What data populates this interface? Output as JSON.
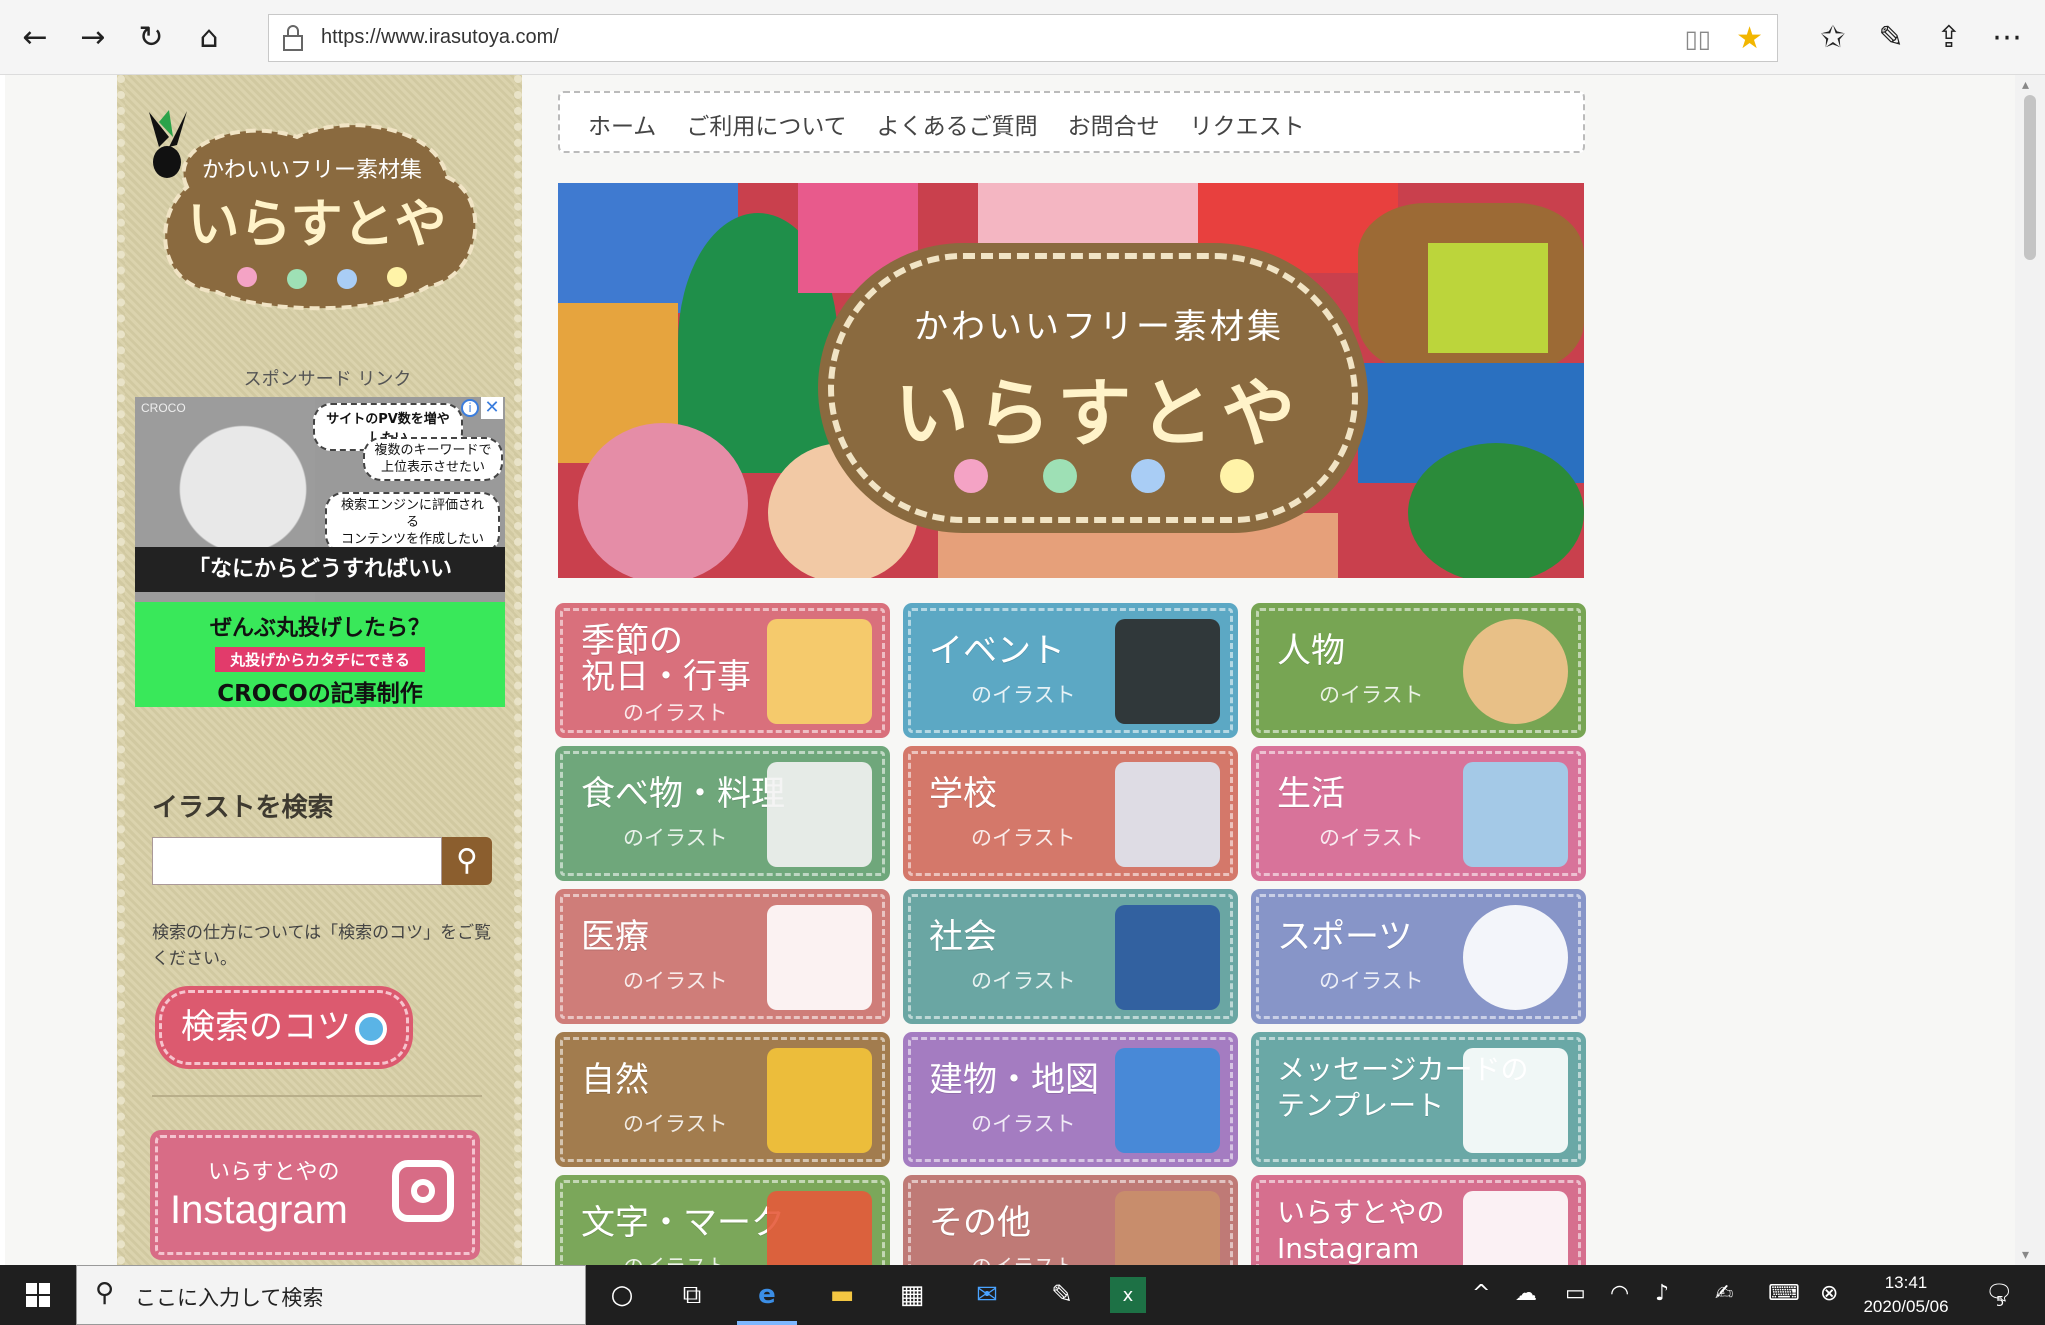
{
  "browser": {
    "url": "https://www.irasutoya.com/",
    "nav_icons": [
      "back-icon",
      "forward-icon",
      "refresh-icon",
      "home-icon"
    ],
    "right_icons": [
      "favorites-icon",
      "pen-icon",
      "share-icon",
      "more-icon"
    ]
  },
  "site": {
    "logo": {
      "small": "かわいいフリー素材集",
      "big": "いらすとや"
    },
    "sponsor_label": "スポンサード リンク",
    "ad": {
      "brand_tag": "CROCO",
      "bubble1": "サイトのPV数を増やしたい",
      "bubble2_l1": "複数のキーワードで",
      "bubble2_l2": "上位表示させたい",
      "bubble3_l1": "検索エンジンに評価される",
      "bubble3_l2": "コンテンツを作成したい",
      "mid": "「なにからどうすればいいの・・・？」",
      "g1": "ぜんぶ丸投げしたら？",
      "g2": "丸投げからカタチにできる",
      "g3": "CROCOの記事制作"
    },
    "search": {
      "title": "イラストを検索",
      "input_value": "",
      "note": "検索の仕方については「検索のコツ」をご覧ください。",
      "tips_button": "検索のコツ"
    },
    "instagram": {
      "small": "いらすとやの",
      "big": "Instagram"
    },
    "nav": [
      "ホーム",
      "ご利用について",
      "よくあるご質問",
      "お問合せ",
      "リクエスト"
    ],
    "hero": {
      "small": "かわいいフリー素材集",
      "big": "いらすとや"
    },
    "categories": [
      {
        "title": "季節の\n祝日・行事",
        "sub": "のイラスト",
        "color": "#d9707c"
      },
      {
        "title": "イベント",
        "sub": "のイラスト",
        "color": "#5ca8c4"
      },
      {
        "title": "人物",
        "sub": "のイラスト",
        "color": "#77a553"
      },
      {
        "title": "食べ物・料理",
        "sub": "のイラスト",
        "color": "#6fa77b"
      },
      {
        "title": "学校",
        "sub": "のイラスト",
        "color": "#d4786a"
      },
      {
        "title": "生活",
        "sub": "のイラスト",
        "color": "#d8739a"
      },
      {
        "title": "医療",
        "sub": "のイラスト",
        "color": "#cf7d79"
      },
      {
        "title": "社会",
        "sub": "のイラスト",
        "color": "#6aa6a3"
      },
      {
        "title": "スポーツ",
        "sub": "のイラスト",
        "color": "#8795c8"
      },
      {
        "title": "自然",
        "sub": "のイラスト",
        "color": "#a27c4e"
      },
      {
        "title": "建物・地図",
        "sub": "のイラスト",
        "color": "#a47cc1"
      },
      {
        "title": "メッセージカードの\nテンプレート",
        "sub": "",
        "color": "#6aa8a6"
      },
      {
        "title": "文字・マーク",
        "sub": "のイラスト",
        "color": "#7ba75a"
      },
      {
        "title": "その他",
        "sub": "のイラスト",
        "color": "#bf7a76"
      },
      {
        "title": "いらすとやの\nInstagram",
        "sub": "",
        "color": "#d66f8e"
      }
    ]
  },
  "taskbar": {
    "search_placeholder": "ここに入力して検索",
    "time": "13:41",
    "date": "2020/05/06",
    "notification_count": "5"
  }
}
